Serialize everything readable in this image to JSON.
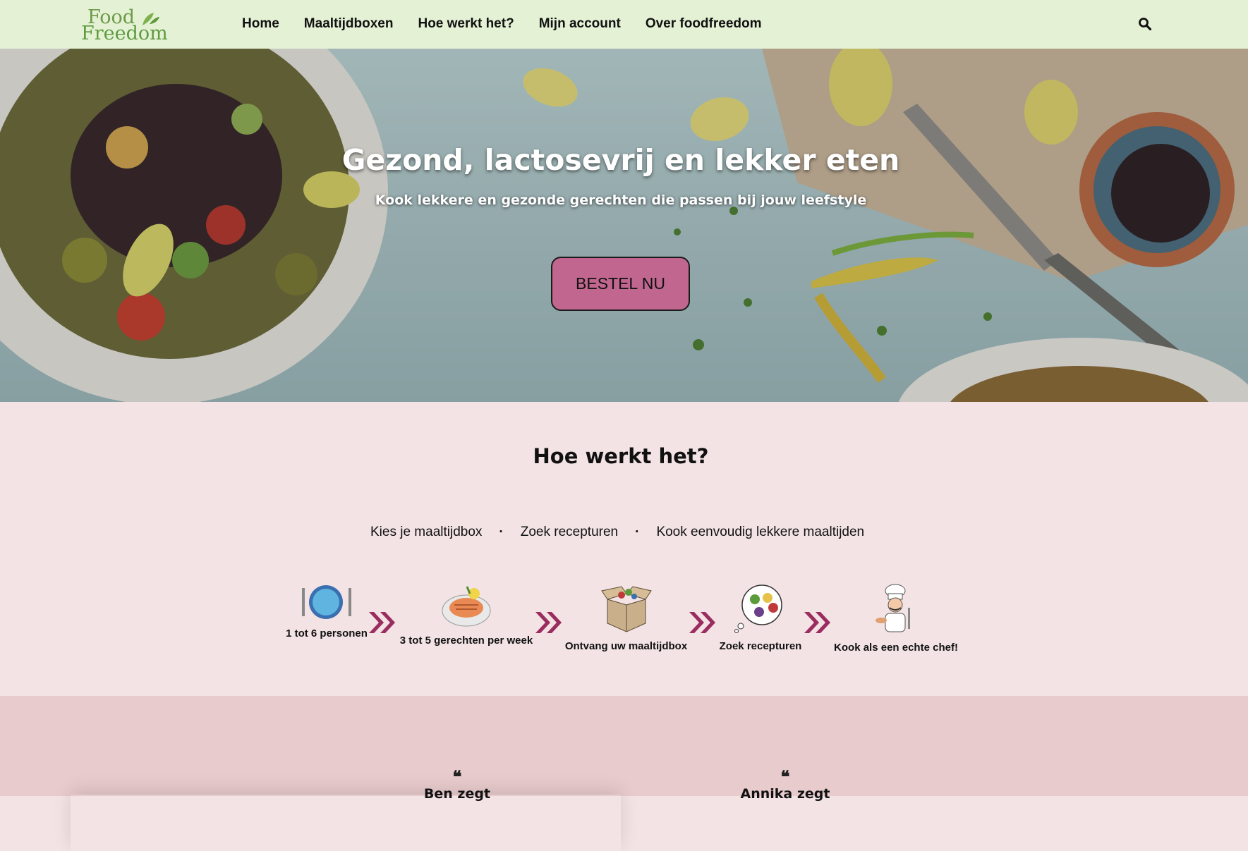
{
  "logo": {
    "line1": "Food",
    "line2": "Freedom"
  },
  "nav": {
    "items": [
      {
        "label": "Home"
      },
      {
        "label": "Maaltijdboxen"
      },
      {
        "label": "Hoe werkt het?"
      },
      {
        "label": "Mijn account"
      },
      {
        "label": "Over foodfreedom"
      }
    ]
  },
  "hero": {
    "title": "Gezond, lactosevrij en lekker eten",
    "subtitle": "Kook lekkere en gezonde gerechten die passen bij jouw leefstyle",
    "cta": "BESTEL NU"
  },
  "how": {
    "title": "Hoe werkt het?",
    "summary": [
      "Kies je maaltijdbox",
      "Zoek recepturen",
      "Kook eenvoudig lekkere maaltijden"
    ],
    "separator": "·",
    "steps": [
      {
        "label": "1 tot 6 personen",
        "icon": "plate-icon"
      },
      {
        "label": "3 tot 5 gerechten per week",
        "icon": "dish-icon"
      },
      {
        "label": "Ontvang uw maaltijdbox",
        "icon": "box-icon"
      },
      {
        "label": "Zoek recepturen",
        "icon": "thought-icon"
      },
      {
        "label": "Kook als een echte chef!",
        "icon": "chef-icon"
      }
    ]
  },
  "testimonials": {
    "quote_glyph": "❝",
    "items": [
      {
        "name": "Ben zegt"
      },
      {
        "name": "Annika zegt"
      }
    ]
  },
  "colors": {
    "nav_bg": "#e4f1d5",
    "cta_bg": "#c0668f",
    "section_bg": "#f3e3e4",
    "testimonial_bg": "#e8cbcd",
    "chevron": "#9b2c5f",
    "logo_green": "#6d9b47"
  }
}
